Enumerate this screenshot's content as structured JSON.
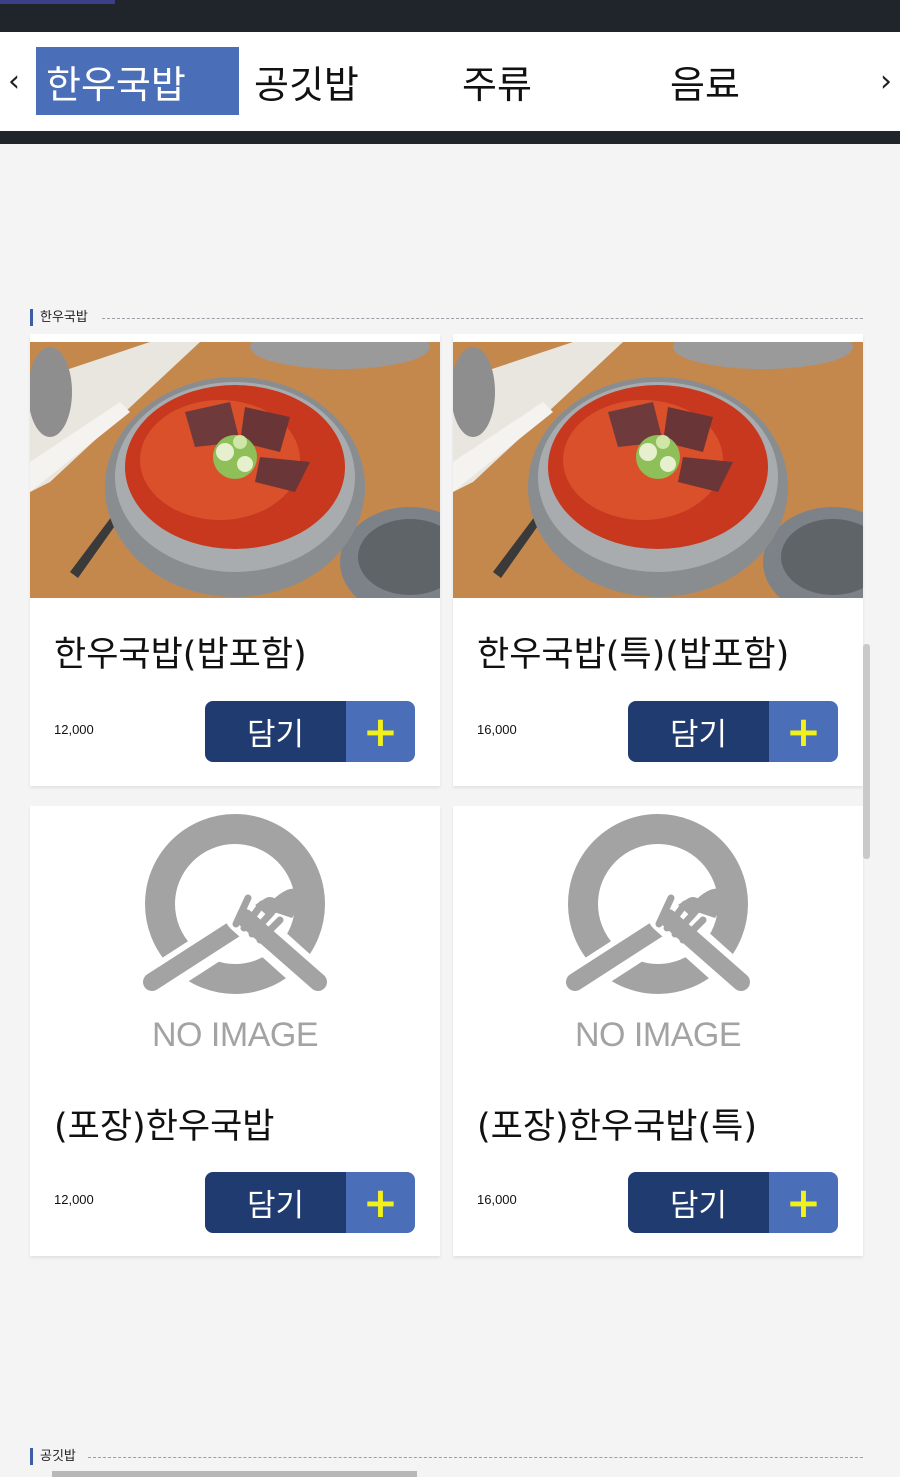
{
  "nav": {
    "prev_icon": "chevron-left-icon",
    "next_icon": "chevron-right-icon",
    "prev_glyph": "‹",
    "next_glyph": "›",
    "tabs": [
      {
        "label": "한우국밥",
        "active": true
      },
      {
        "label": "공깃밥",
        "active": false
      },
      {
        "label": "주류",
        "active": false
      },
      {
        "label": "음료",
        "active": false
      }
    ]
  },
  "sections": [
    {
      "title": "한우국밥",
      "items": [
        {
          "name": "한우국밥(밥포함)",
          "price": "12,000",
          "image": "gukbap-photo",
          "add_label": "담기",
          "add_icon": "+"
        },
        {
          "name": "한우국밥(특)(밥포함)",
          "price": "16,000",
          "image": "gukbap-photo",
          "add_label": "담기",
          "add_icon": "+"
        },
        {
          "name": "(포장)한우국밥",
          "price": "12,000",
          "image": "no-image-placeholder",
          "placeholder_text": "NO IMAGE",
          "add_label": "담기",
          "add_icon": "+"
        },
        {
          "name": "(포장)한우국밥(특)",
          "price": "16,000",
          "image": "no-image-placeholder",
          "placeholder_text": "NO IMAGE",
          "add_label": "담기",
          "add_icon": "+"
        }
      ]
    },
    {
      "title": "공깃밥",
      "items": []
    }
  ],
  "colors": {
    "top_bar": "#1f252b",
    "active_tab": "#4a6fb8",
    "button_dark": "#1f3b70",
    "button_light": "#4a6fb8",
    "plus": "#f2f01a",
    "placeholder_gray": "#a3a3a3"
  }
}
